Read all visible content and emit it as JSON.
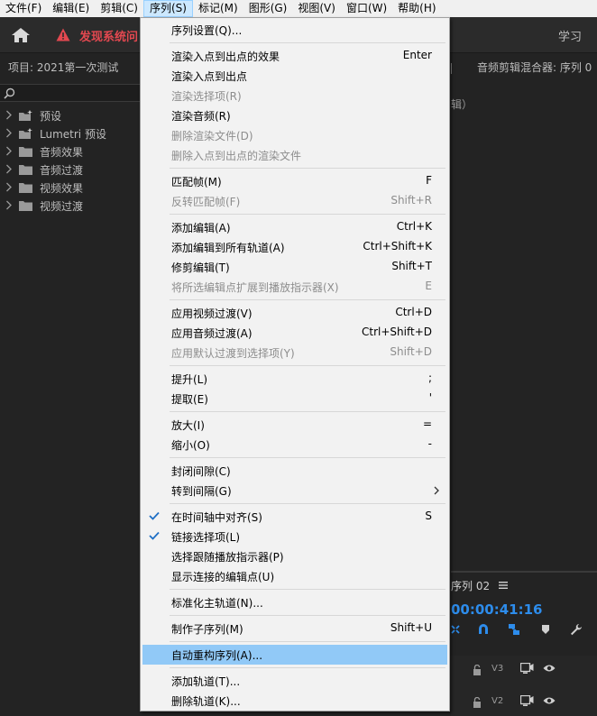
{
  "menubar": {
    "items": [
      {
        "label": "文件(F)",
        "active": false
      },
      {
        "label": "编辑(E)",
        "active": false
      },
      {
        "label": "剪辑(C)",
        "active": false
      },
      {
        "label": "序列(S)",
        "active": true
      },
      {
        "label": "标记(M)",
        "active": false
      },
      {
        "label": "图形(G)",
        "active": false
      },
      {
        "label": "视图(V)",
        "active": false
      },
      {
        "label": "窗口(W)",
        "active": false
      },
      {
        "label": "帮助(H)",
        "active": false
      }
    ]
  },
  "header": {
    "home_icon": "home-icon",
    "warning_icon": "warning-icon",
    "warning_text": "发现系统问",
    "learn_tab": "学习"
  },
  "project_panel": {
    "title": "项目: 2021第一次测试",
    "search_icon": "search-icon",
    "items": [
      {
        "label": "预设",
        "icon": "preset-folder-icon"
      },
      {
        "label": "Lumetri 预设",
        "icon": "preset-folder-icon"
      },
      {
        "label": "音频效果",
        "icon": "folder-icon"
      },
      {
        "label": "音频过渡",
        "icon": "folder-icon"
      },
      {
        "label": "视频效果",
        "icon": "folder-icon"
      },
      {
        "label": "视频过渡",
        "icon": "folder-icon"
      }
    ]
  },
  "right_panel": {
    "mixer_tab": "音频剪辑混合器: 序列 0",
    "mixer_sub": "辑）",
    "sequence_tab": "序列 02",
    "timecode": "00:00:41:16",
    "tracks": [
      {
        "name": "V3"
      },
      {
        "name": "V2"
      }
    ]
  },
  "menu": {
    "items": [
      {
        "type": "item",
        "label": "序列设置(Q)...",
        "shortcut": "",
        "disabled": false
      },
      {
        "type": "sep"
      },
      {
        "type": "item",
        "label": "渲染入点到出点的效果",
        "shortcut": "Enter",
        "disabled": false
      },
      {
        "type": "item",
        "label": "渲染入点到出点",
        "shortcut": "",
        "disabled": false
      },
      {
        "type": "item",
        "label": "渲染选择项(R)",
        "shortcut": "",
        "disabled": true
      },
      {
        "type": "item",
        "label": "渲染音频(R)",
        "shortcut": "",
        "disabled": false
      },
      {
        "type": "item",
        "label": "删除渲染文件(D)",
        "shortcut": "",
        "disabled": true
      },
      {
        "type": "item",
        "label": "删除入点到出点的渲染文件",
        "shortcut": "",
        "disabled": true
      },
      {
        "type": "sep"
      },
      {
        "type": "item",
        "label": "匹配帧(M)",
        "shortcut": "F",
        "disabled": false
      },
      {
        "type": "item",
        "label": "反转匹配帧(F)",
        "shortcut": "Shift+R",
        "disabled": true
      },
      {
        "type": "sep"
      },
      {
        "type": "item",
        "label": "添加编辑(A)",
        "shortcut": "Ctrl+K",
        "disabled": false
      },
      {
        "type": "item",
        "label": "添加编辑到所有轨道(A)",
        "shortcut": "Ctrl+Shift+K",
        "disabled": false
      },
      {
        "type": "item",
        "label": "修剪编辑(T)",
        "shortcut": "Shift+T",
        "disabled": false
      },
      {
        "type": "item",
        "label": "将所选编辑点扩展到播放指示器(X)",
        "shortcut": "E",
        "disabled": true
      },
      {
        "type": "sep"
      },
      {
        "type": "item",
        "label": "应用视频过渡(V)",
        "shortcut": "Ctrl+D",
        "disabled": false
      },
      {
        "type": "item",
        "label": "应用音频过渡(A)",
        "shortcut": "Ctrl+Shift+D",
        "disabled": false
      },
      {
        "type": "item",
        "label": "应用默认过渡到选择项(Y)",
        "shortcut": "Shift+D",
        "disabled": true
      },
      {
        "type": "sep"
      },
      {
        "type": "item",
        "label": "提升(L)",
        "shortcut": ";",
        "disabled": false
      },
      {
        "type": "item",
        "label": "提取(E)",
        "shortcut": "'",
        "disabled": false
      },
      {
        "type": "sep"
      },
      {
        "type": "item",
        "label": "放大(I)",
        "shortcut": "=",
        "disabled": false
      },
      {
        "type": "item",
        "label": "缩小(O)",
        "shortcut": "-",
        "disabled": false
      },
      {
        "type": "sep"
      },
      {
        "type": "item",
        "label": "封闭间隙(C)",
        "shortcut": "",
        "disabled": false
      },
      {
        "type": "item",
        "label": "转到间隔(G)",
        "shortcut": "",
        "disabled": false,
        "submenu": true
      },
      {
        "type": "sep"
      },
      {
        "type": "item",
        "label": "在时间轴中对齐(S)",
        "shortcut": "S",
        "disabled": false,
        "checked": true
      },
      {
        "type": "item",
        "label": "链接选择项(L)",
        "shortcut": "",
        "disabled": false,
        "checked": true
      },
      {
        "type": "item",
        "label": "选择跟随播放指示器(P)",
        "shortcut": "",
        "disabled": false
      },
      {
        "type": "item",
        "label": "显示连接的编辑点(U)",
        "shortcut": "",
        "disabled": false
      },
      {
        "type": "sep"
      },
      {
        "type": "item",
        "label": "标准化主轨道(N)...",
        "shortcut": "",
        "disabled": false
      },
      {
        "type": "sep"
      },
      {
        "type": "item",
        "label": "制作子序列(M)",
        "shortcut": "Shift+U",
        "disabled": false
      },
      {
        "type": "sep"
      },
      {
        "type": "item",
        "label": "自动重构序列(A)...",
        "shortcut": "",
        "disabled": false,
        "highlighted": true
      },
      {
        "type": "sep"
      },
      {
        "type": "item",
        "label": "添加轨道(T)...",
        "shortcut": "",
        "disabled": false
      },
      {
        "type": "item",
        "label": "删除轨道(K)...",
        "shortcut": "",
        "disabled": false
      }
    ]
  },
  "colors": {
    "highlight": "#91c9f7",
    "timecode": "#2d8ceb",
    "warning": "#e34850",
    "check": "#1f6fc5"
  }
}
